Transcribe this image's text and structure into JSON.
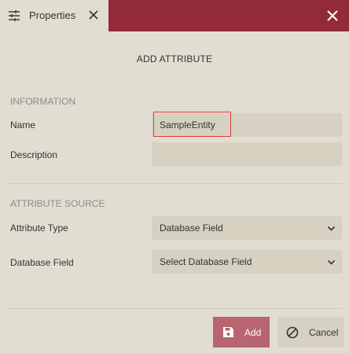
{
  "tab": {
    "label": "Properties",
    "icon": "sliders-icon"
  },
  "dialog": {
    "title": "ADD ATTRIBUTE"
  },
  "information": {
    "section_title": "INFORMATION",
    "name_label": "Name",
    "name_value": "SampleEntity",
    "description_label": "Description",
    "description_value": ""
  },
  "attribute_source": {
    "section_title": "ATTRIBUTE SOURCE",
    "type_label": "Attribute Type",
    "type_value": "Database Field",
    "db_field_label": "Database Field",
    "db_field_value": "Select Database Field"
  },
  "buttons": {
    "add_label": "Add",
    "cancel_label": "Cancel"
  },
  "colors": {
    "header": "#922a3a",
    "background": "#e2ddd1",
    "input": "#d6d1c1",
    "add_button": "#b7656e",
    "highlight": "#e03b3b"
  }
}
